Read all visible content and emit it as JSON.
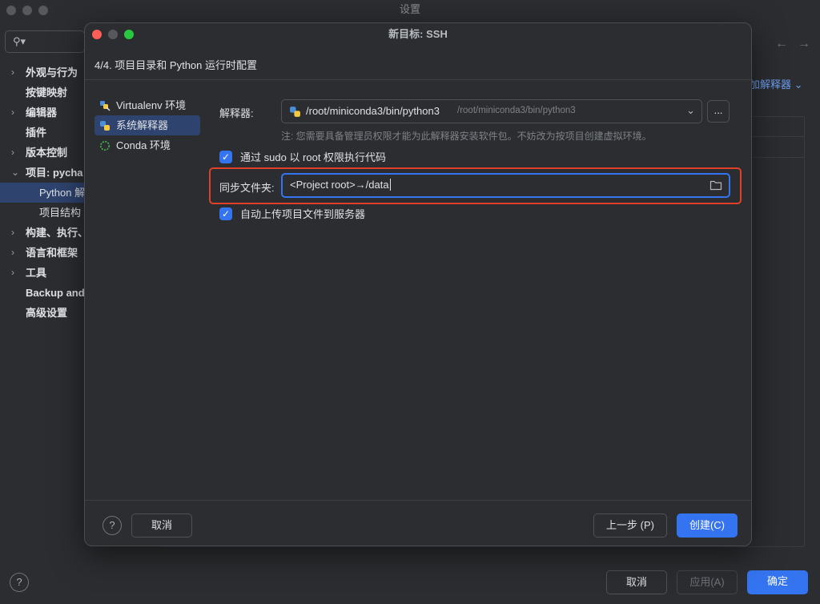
{
  "colors": {
    "accent": "#3574f0",
    "highlight_border": "#e0402a",
    "background": "#2b2d30",
    "selection": "#2e436e"
  },
  "settings_window": {
    "title": "设置",
    "search_icon": "search-icon",
    "nav": [
      {
        "label": "外观与行为",
        "expandable": true
      },
      {
        "label": "按键映射",
        "expandable": false
      },
      {
        "label": "编辑器",
        "expandable": true
      },
      {
        "label": "插件",
        "expandable": false
      },
      {
        "label": "版本控制",
        "expandable": true
      },
      {
        "label": "项目: pycha",
        "expanded": true
      },
      {
        "label": "Python 解",
        "sub": true,
        "selected": true
      },
      {
        "label": "项目结构",
        "sub": true
      },
      {
        "label": "构建、执行、",
        "expandable": true
      },
      {
        "label": "语言和框架",
        "expandable": true
      },
      {
        "label": "工具",
        "expandable": true
      },
      {
        "label": "Backup and",
        "expandable": false
      },
      {
        "label": "高级设置",
        "expandable": false
      }
    ],
    "add_interpreter_label": "加解释器",
    "help_label": "?",
    "cancel_label": "取消",
    "apply_label": "应用(A)",
    "ok_label": "确定"
  },
  "dialog": {
    "title": "新目标: SSH",
    "step_title": "4/4. 项目目录和 Python 运行时配置",
    "environments": [
      {
        "label": "Virtualenv 环境",
        "icon": "virtualenv-icon",
        "selected": false
      },
      {
        "label": "系统解释器",
        "icon": "python-icon",
        "selected": true
      },
      {
        "label": "Conda 环境",
        "icon": "conda-icon",
        "selected": false
      }
    ],
    "interpreter_label": "解释器:",
    "interpreter_path": "/root/miniconda3/bin/python3",
    "interpreter_path_hint": "/root/miniconda3/bin/python3",
    "browse_label": "...",
    "note": "注: 您需要具备管理员权限才能为此解释器安装软件包。不妨改为按项目创建虚拟环境。",
    "sudo_label": "通过 sudo 以 root 权限执行代码",
    "sudo_checked": true,
    "sync_folder_label": "同步文件夹:",
    "sync_folder_value": "<Project root>→/data",
    "auto_upload_label": "自动上传项目文件到服务器",
    "auto_upload_checked": true,
    "help_label": "?",
    "cancel_label": "取消",
    "back_label": "上一步 (P)",
    "create_label": "创建(C)"
  }
}
